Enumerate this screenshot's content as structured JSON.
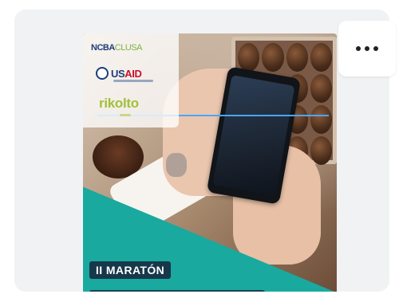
{
  "post": {
    "logos": {
      "ncba": "NCBA",
      "clusa": "CLUSA",
      "us": "US",
      "aid": "AID",
      "rikolto": "rikolto"
    },
    "badge_text": "II MARATÓN"
  },
  "menu": {
    "more_icon": "more-horizontal-icon"
  },
  "colors": {
    "card_bg": "#f1f2f4",
    "teal": "#19a99f",
    "badge_bg": "#17384a",
    "usaid_blue": "#1e3d7a",
    "usaid_red": "#c8102e",
    "rikolto_green": "#a2c13a"
  }
}
